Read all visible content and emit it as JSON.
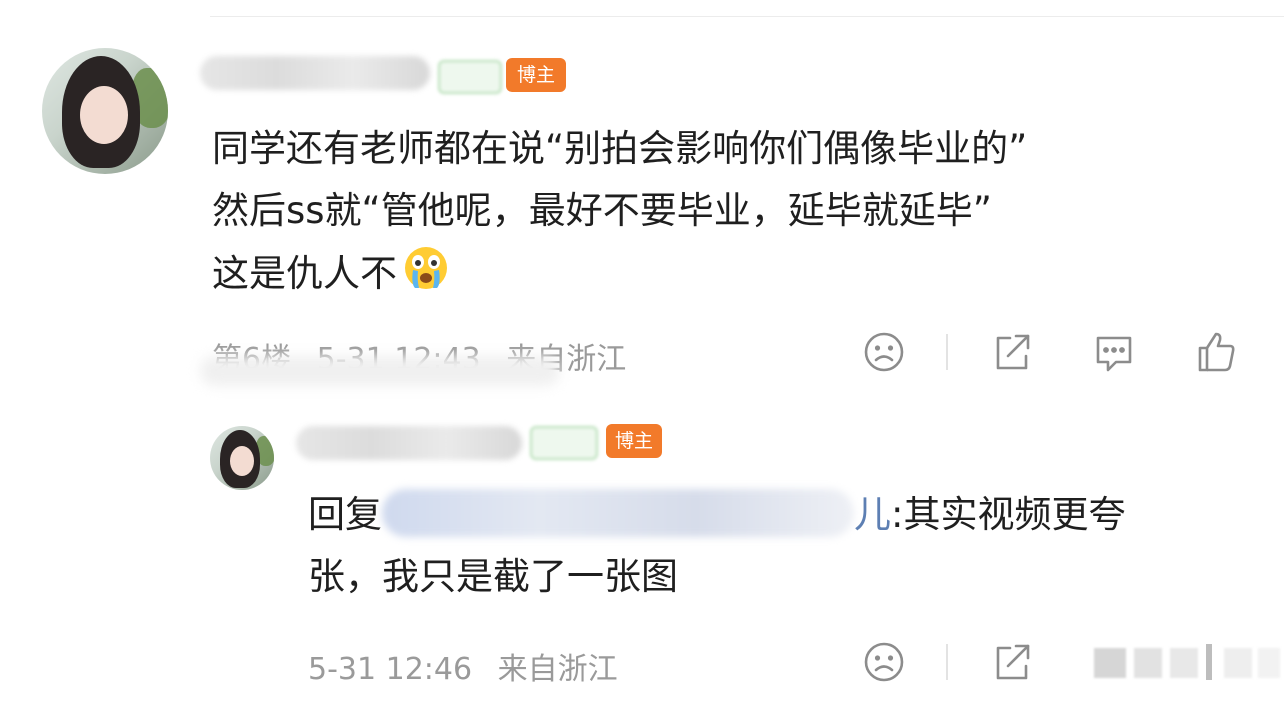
{
  "comment": {
    "badge_blogger": "博主",
    "text_lines": [
      "同学还有老师都在说“别拍会影响你们偶像毕业的”",
      "然后ss就“管他呢，最好不要毕业，延毕就延毕”",
      "这是仇人不"
    ],
    "emoji_icon": "crying-face-icon",
    "floor": "第6楼",
    "time": "5-31 12:43",
    "location": "来自浙江"
  },
  "reply": {
    "badge_blogger": "博主",
    "prefix": "回复",
    "mention_tail": "儿",
    "text_after": ":其实视频更夸",
    "text_line2": "张，我只是截了一张图",
    "time": "5-31 12:46",
    "location": "来自浙江"
  },
  "icons": {
    "dislike": "frown-face-icon",
    "share": "share-icon",
    "comment": "comment-icon",
    "like": "thumbs-up-icon"
  },
  "colors": {
    "text": "#1f1f1f",
    "meta": "#9a9a9a",
    "blogger_badge": "#f27a2a",
    "icon": "#8c8c8c"
  }
}
